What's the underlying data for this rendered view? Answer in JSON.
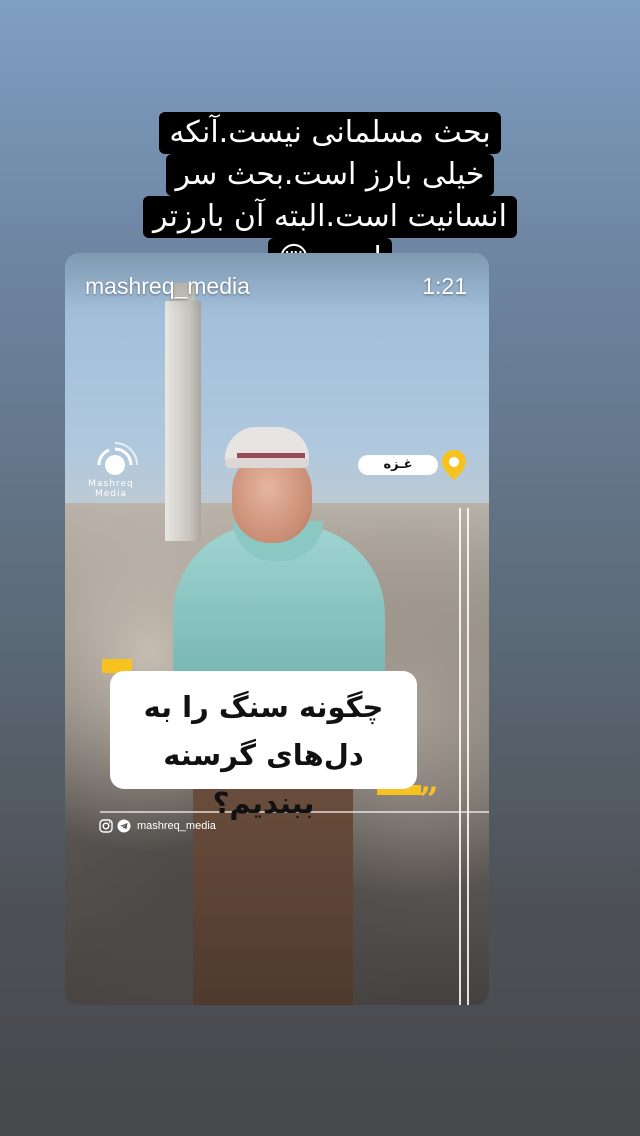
{
  "story_caption": {
    "lines": [
      "بحث مسلمانی نیست.آنکه",
      "خیلی بارز است.بحث سر",
      "انسانیت است.البته آن بارزتر",
      "است.😔"
    ]
  },
  "video_post": {
    "username": "mashreq_media",
    "duration": "1:21",
    "watermark_logo_text": "Mashreq Media",
    "location_tag": "غـزه",
    "quote_lines": [
      "چگونه سنگ را به",
      "دل‌های گرسنه ببندیم؟"
    ],
    "quote_mark": "”",
    "social_handle": "mashreq_media",
    "icons": [
      "instagram-icon",
      "telegram-icon",
      "location-pin-icon"
    ]
  },
  "colors": {
    "accent_yellow": "#f7c21f",
    "caption_background": "#000000",
    "text_white": "#ffffff"
  }
}
